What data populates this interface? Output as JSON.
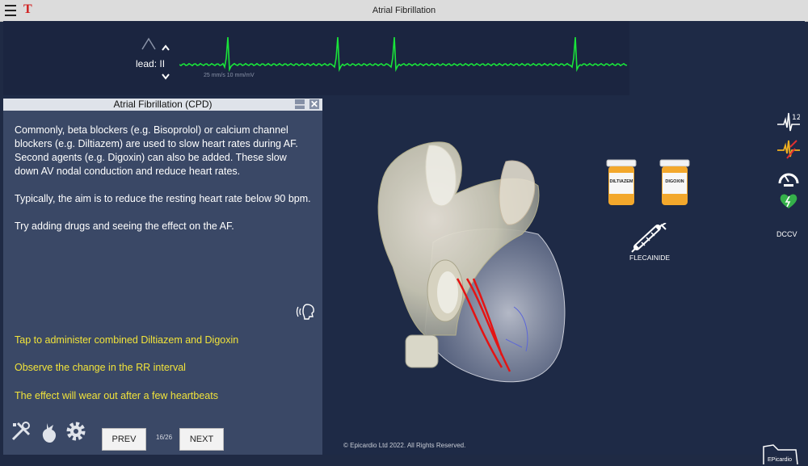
{
  "window": {
    "title": "Atrial Fibrillation",
    "logo_letter": "T"
  },
  "ecg": {
    "lead_label": "lead: II",
    "scale_text": "25 mm/s  10 mm/mV",
    "trace_color": "#19e43a"
  },
  "cpd": {
    "title": "Atrial Fibrillation (CPD)",
    "minimize": "—",
    "close": "✕",
    "paragraphs": [
      "Commonly, beta blockers (e.g. Bisoprolol) or calcium channel blockers (e.g. Diltiazem) are used to slow heart rates during AF. Second agents (e.g. Digoxin) can also be added.  These slow down AV nodal conduction and reduce heart rates.",
      "Typically, the aim is to reduce the resting heart rate below 90 bpm.",
      "Try adding drugs and seeing the effect on the AF."
    ],
    "actions": [
      "Tap to administer combined Diltiazem and Digoxin",
      "Observe the change in the RR interval",
      "The effect will wear out after a few heartbeats"
    ],
    "accent": "#f1e33a"
  },
  "nav": {
    "prev": "PREV",
    "next": "NEXT",
    "page": "16/26"
  },
  "drugs": [
    {
      "name": "DILTIAZEM"
    },
    {
      "name": "DIGOXIN"
    }
  ],
  "injection": {
    "name": "FLECAINIDE"
  },
  "side": {
    "ecg12_icon": "ecg-12-lead-icon",
    "dccv_label": "DCCV"
  },
  "footer": {
    "copyright": "© Epicardio Ltd 2022. All Rights Reserved.",
    "brand": "EPicardio"
  }
}
